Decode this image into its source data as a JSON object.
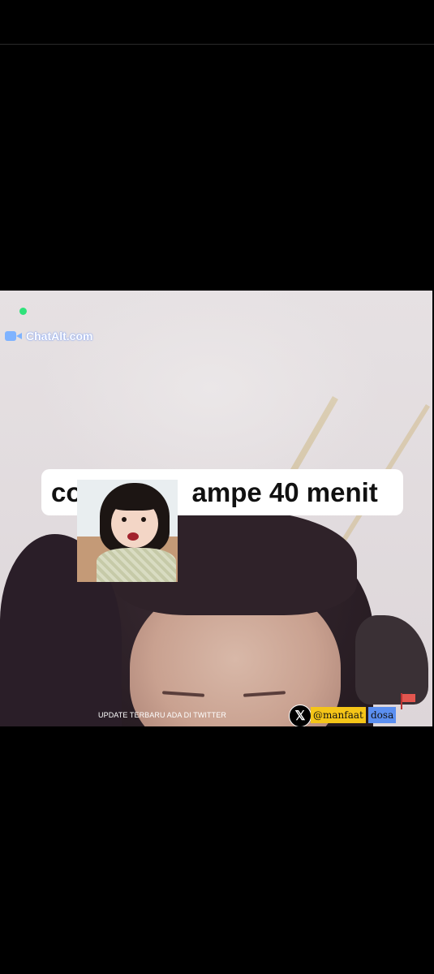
{
  "watermark": {
    "text": "ChatAlt.com",
    "icon": "video-camera-icon",
    "status_dot_color": "#2fe27a"
  },
  "caption": {
    "visible_start": "co",
    "visible_end": "ampe 40 menit"
  },
  "footer": {
    "update_text": "UPDATE TERBARU ADA DI TWITTER",
    "twitter_icon": "x-logo-icon",
    "handle_part1": "@manfaat",
    "handle_part2": "dosa",
    "handle_part1_color": "#f5c518",
    "handle_part2_color": "#5b8ff0"
  }
}
